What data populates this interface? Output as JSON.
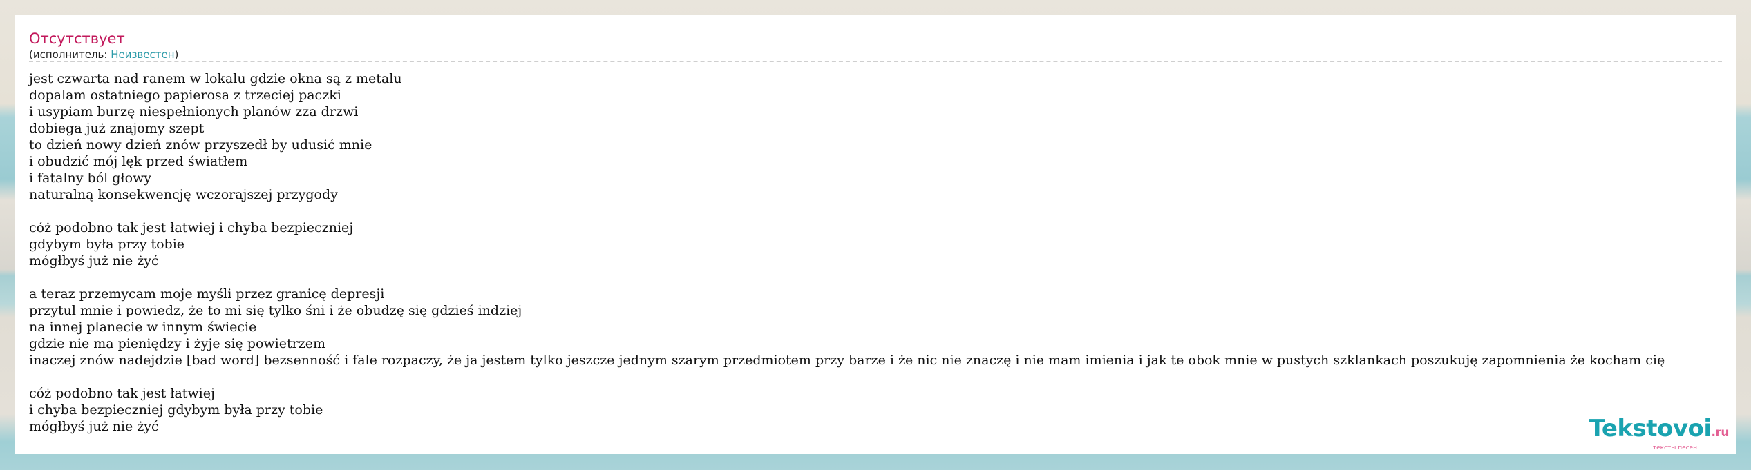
{
  "song": {
    "title": "Отсутствует",
    "artist_prefix": "(исполнитель: ",
    "artist_name": "Неизвестен",
    "artist_suffix": ")"
  },
  "lyrics": [
    "jest czwarta nad ranem w lokalu gdzie okna są z metalu",
    "dopalam ostatniego papierosa z trzeciej paczki",
    "i usypiam burzę niespełnionych planów zza drzwi",
    "dobiega już znajomy szept",
    "to dzień nowy dzień znów przyszedł by udusić mnie",
    "i obudzić mój lęk przed światłem",
    "i fatalny ból głowy",
    "naturalną konsekwencję wczorajszej przygody",
    "",
    "cóż podobno tak jest łatwiej i chyba bezpieczniej",
    "gdybym była przy tobie",
    "mógłbyś już nie żyć",
    "",
    "a teraz przemycam moje myśli przez granicę depresji",
    "przytul mnie i powiedz, że to mi się tylko śni i że obudzę się gdzieś indziej",
    "na innej planecie w innym świecie",
    "gdzie nie ma pieniędzy i żyje się powietrzem",
    "inaczej znów nadejdzie [bad word] bezsenność i fale rozpaczy, że ja jestem tylko jeszcze jednym szarym przedmiotem przy barze i że nic nie znaczę i nie mam imienia i jak te obok mnie w pustych szklankach poszukuję zapomnienia że kocham cię",
    "",
    "cóż podobno tak jest łatwiej",
    "i chyba bezpieczniej gdybym była przy tobie",
    "mógłbyś już nie żyć"
  ],
  "logo": {
    "main": "Tekstovoi",
    "tld": ".ru",
    "tagline": "тексты песен"
  },
  "colors": {
    "title": "#c2185b",
    "artist_link": "#2a9aa8",
    "logo_main": "#1aa3b0",
    "logo_accent": "#e35f93"
  }
}
